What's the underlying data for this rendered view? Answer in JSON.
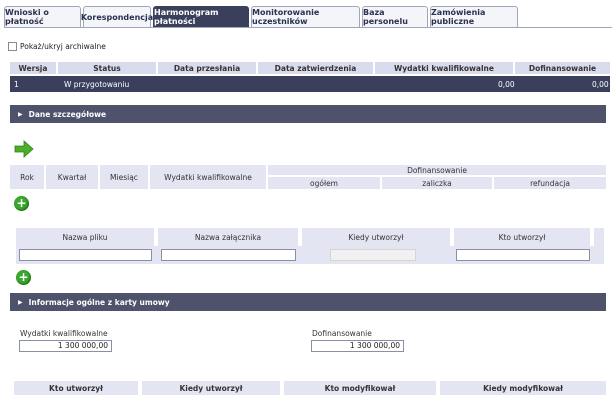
{
  "tabs": [
    "Wnioski o płatność",
    "Korespondencja",
    "Harmonogram płatności",
    "Monitorowanie uczestników",
    "Baza personelu",
    "Zamówienia publiczne"
  ],
  "archive_label": "Pokaż/ukryj archiwalne",
  "versions_table": {
    "headers": [
      "Wersja",
      "Status",
      "Data przesłania",
      "Data zatwierdzenia",
      "Wydatki kwalifikowalne",
      "Dofinansowanie"
    ],
    "row": {
      "version": "1",
      "status": "W przygotowaniu",
      "wydatki": "0,00",
      "dofinansowanie": "0,00"
    }
  },
  "section_details": "Dane szczegółowe",
  "schedule_headers": {
    "rok": "Rok",
    "kwartal": "Kwartał",
    "miesiac": "Miesiąc",
    "wydatki": "Wydatki kwalifikowalne",
    "dofinansowanie": "Dofinansowanie",
    "ogolem": "ogółem",
    "zaliczka": "zaliczka",
    "refundacja": "refundacja"
  },
  "attachments_headers": [
    "Nazwa pliku",
    "Nazwa załącznika",
    "Kiedy utworzył",
    "Kto utworzył"
  ],
  "section_general": "Informacje ogólne z karty umowy",
  "general": {
    "wydatki_label": "Wydatki kwalifikowalne",
    "wydatki_value": "1 300 000,00",
    "dofinansowanie_label": "Dofinansowanie",
    "dofinansowanie_value": "1 300 000,00"
  },
  "footer_headers": [
    "Kto utworzył",
    "Kiedy utworzył",
    "Kto modyfikował",
    "Kiedy modyfikował"
  ],
  "colors": {
    "tab_active": "#3a3f5c",
    "header_bg": "#d9dcec",
    "section_bg": "#4e536b",
    "add_green": "#3aa82e",
    "arrow_green": "#4caf2a"
  }
}
